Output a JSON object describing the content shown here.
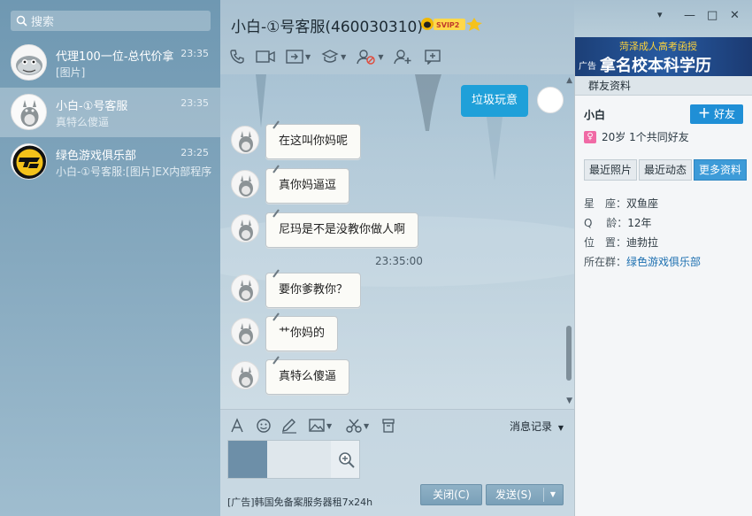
{
  "search": {
    "placeholder": "搜索"
  },
  "conversations": [
    {
      "name": "代理100一位-总代价拿",
      "preview": "[图片]",
      "time": "23:35"
    },
    {
      "name": "小白-①号客服",
      "preview": "真特么傻逼",
      "time": "23:35"
    },
    {
      "name": "绿色游戏俱乐部",
      "preview": "小白-①号客服:[图片]EX内部程序",
      "time": "23:25"
    }
  ],
  "chat": {
    "title": "小白-①号客服(460030310)",
    "svip_badge": "SVIP2",
    "messages_in": [
      "在这叫你妈呢",
      "真你妈逼逗",
      "尼玛是不是没教你做人啊",
      "要你爹教你？",
      "艹你妈的",
      "真特么傻逼"
    ],
    "message_out": "垃圾玩意",
    "timestamp": "23:35:00",
    "history_label": "消息记录",
    "ad_text": "[广告]韩国免备案服务器租7x24h",
    "close_label": "关闭(C)",
    "send_label": "发送(S)"
  },
  "right": {
    "ad_line1": "菏泽成人高考函授",
    "ad_line2": "拿名校本科学历",
    "ad_tag": "广告",
    "group_info_label": "群友资料",
    "profile_name": "小白",
    "add_friend_label": "好友",
    "profile_sub": "20岁 1个共同好友",
    "tabs": [
      "最近照片",
      "最近动态",
      "更多资料"
    ],
    "info": [
      {
        "key": "星　座：",
        "value": "双鱼座"
      },
      {
        "key": "Q　 龄：",
        "value": "12年"
      },
      {
        "key": "位　置：",
        "value": "迪勃拉"
      },
      {
        "key": "所在群：",
        "value": "绿色游戏俱乐部"
      }
    ]
  },
  "colors": {
    "accent": "#1fa0d9",
    "add_button": "#1f8fd6",
    "active_tab": "#3d9bd8"
  }
}
